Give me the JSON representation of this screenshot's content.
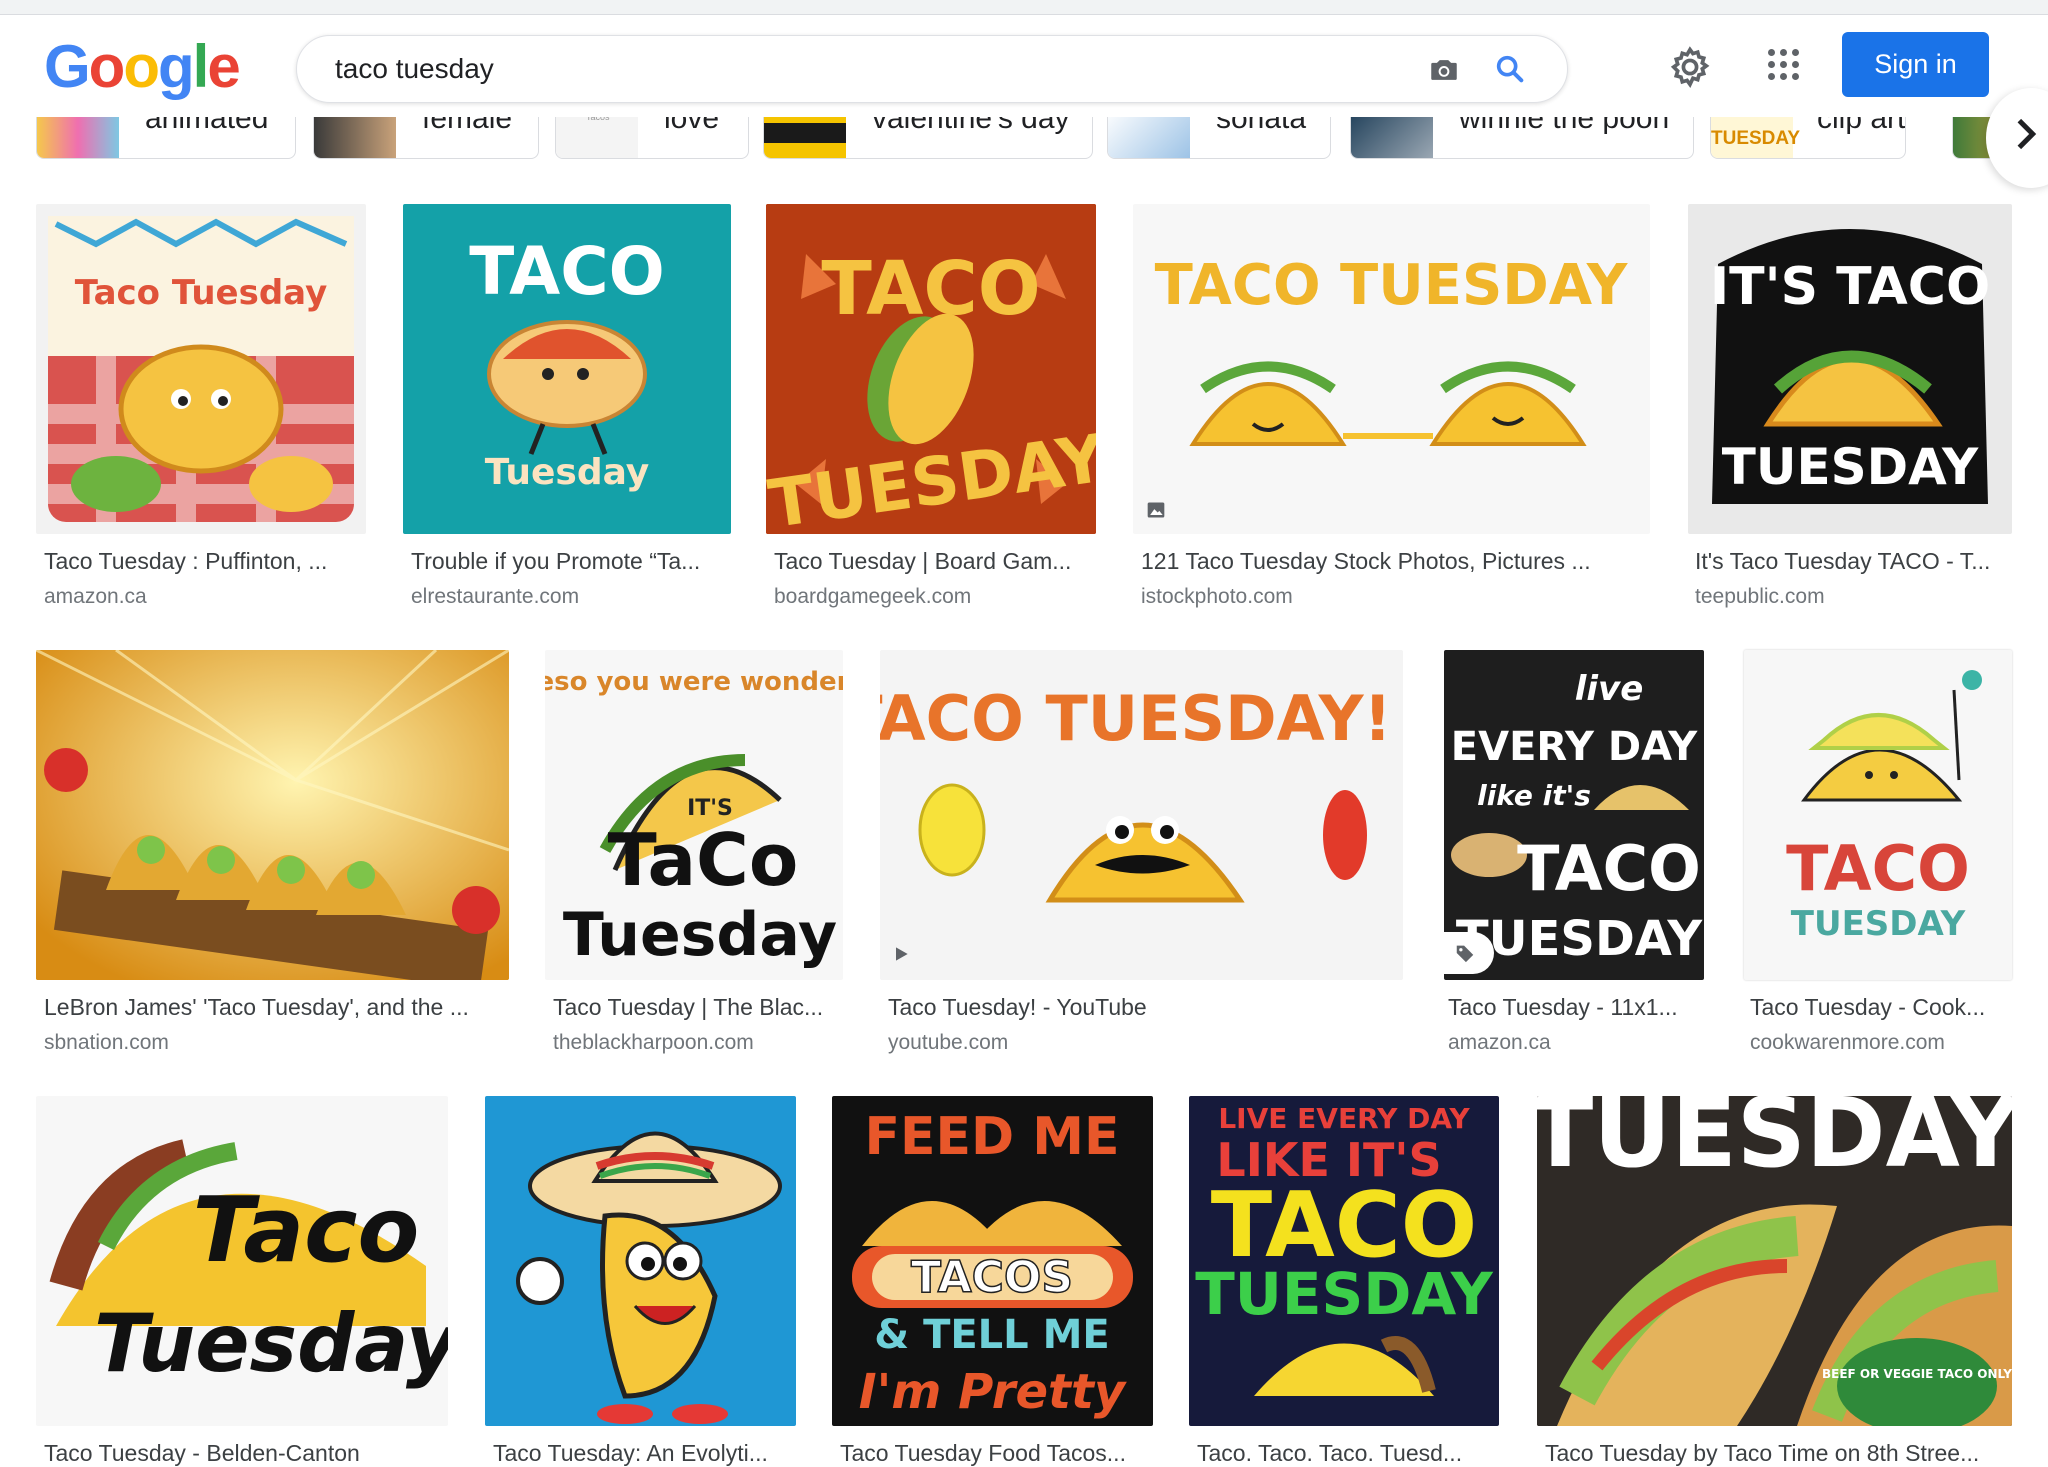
{
  "search": {
    "query": "taco tuesday"
  },
  "header": {
    "sign_in_label": "Sign in"
  },
  "chips": [
    "animated",
    "female",
    "love",
    "valentine's day",
    "sonata",
    "winnie the pooh",
    "clip art"
  ],
  "chip_thumb_text": {
    "clip_art": "TUESDAY",
    "love": "Tacos"
  },
  "results": [
    {
      "caption": "Taco Tuesday : Puffinton, ...",
      "source": "amazon.ca",
      "art": "Taco Tuesday"
    },
    {
      "caption": "Trouble if you Promote “Ta...",
      "source": "elrestaurante.com",
      "art_top": "TACO",
      "art_bottom": "Tuesday"
    },
    {
      "caption": "Taco Tuesday | Board Gam...",
      "source": "boardgamegeek.com",
      "art_top": "TACO",
      "art_bottom": "TUESDAY"
    },
    {
      "caption": "121 Taco Tuesday Stock Photos, Pictures ...",
      "source": "istockphoto.com",
      "art": "TACO TUESDAY"
    },
    {
      "caption": "It's Taco Tuesday TACO - T...",
      "source": "teepublic.com",
      "art_top": "IT'S TACO",
      "art_bottom": "TUESDAY"
    },
    {
      "caption": "LeBron James' 'Taco Tuesday', and the ...",
      "source": "sbnation.com"
    },
    {
      "caption": "Taco Tuesday | The Blac...",
      "source": "theblackharpoon.com",
      "art_top": "in queso you were wondering...",
      "art_mid": "IT'S",
      "art_bottom1": "TaCo",
      "art_bottom2": "Tuesday"
    },
    {
      "caption": "Taco Tuesday! - YouTube",
      "source": "youtube.com",
      "art": "TACO TUESDAY!"
    },
    {
      "caption": "Taco Tuesday - 11x1...",
      "source": "amazon.ca",
      "art1": "live",
      "art2": "EVERY DAY",
      "art3": "like it's",
      "art4": "TACO",
      "art5": "TUESDAY"
    },
    {
      "caption": "Taco Tuesday - Cook...",
      "source": "cookwarenmore.com",
      "art_top": "TACO",
      "art_bottom": "TUESDAY"
    },
    {
      "caption": "Taco Tuesday - Belden-Canton",
      "source": "",
      "art_top": "Taco",
      "art_bottom": "Tuesday"
    },
    {
      "caption": "Taco Tuesday: An Evolyti...",
      "source": ""
    },
    {
      "caption": "Taco Tuesday Food Tacos...",
      "source": "",
      "art1": "FEED ME",
      "art2": "TACOS",
      "art3": "& TELL ME",
      "art4": "I'm Pretty"
    },
    {
      "caption": "Taco. Taco. Taco. Tuesd...",
      "source": "",
      "art1": "LIVE EVERY DAY",
      "art2": "LIKE IT'S",
      "art3": "TACO",
      "art4": "TUESDAY"
    },
    {
      "caption": "Taco Tuesday by Taco Time on 8th Stree...",
      "source": "",
      "art": "TUESDAY",
      "art_badge": "BEEF OR VEGGIE TACO ONLY"
    }
  ],
  "colors": {
    "accent": "#1a73e8",
    "caption": "#3c4043",
    "source": "#70757a"
  }
}
